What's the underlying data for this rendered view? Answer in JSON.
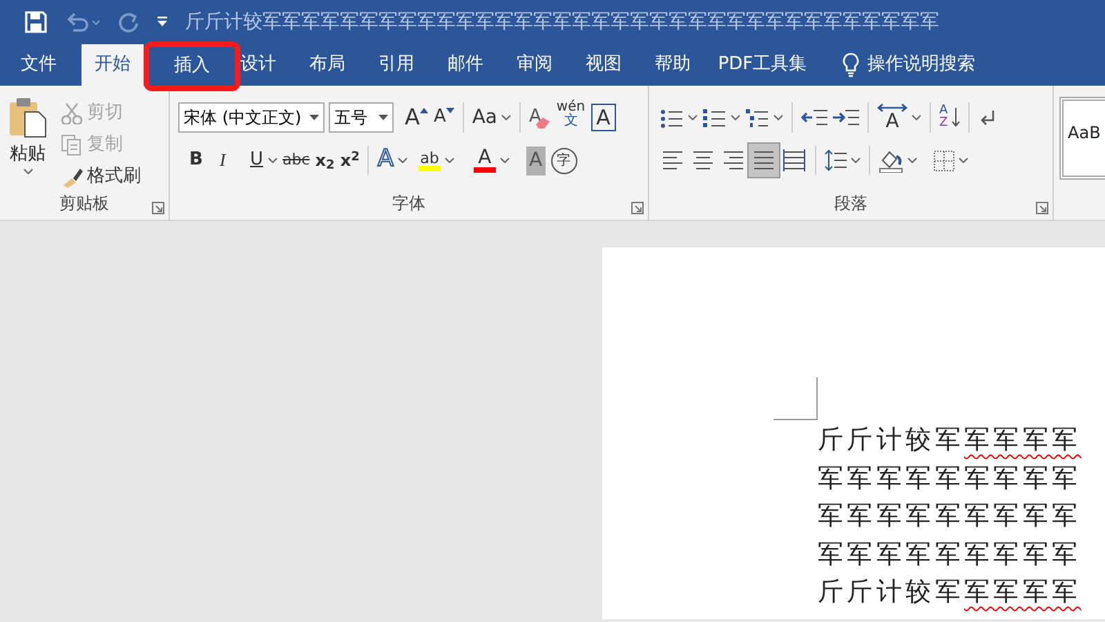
{
  "title_bar": {
    "title": "斤斤计较军军军军军军军军军军军军军军军军军军军军军军军军军军军军军军军军军军军"
  },
  "tabs": [
    {
      "label": "文件",
      "selected": false,
      "highlighted": false
    },
    {
      "label": "开始",
      "selected": true,
      "highlighted": false
    },
    {
      "label": "插入",
      "selected": false,
      "highlighted": true
    },
    {
      "label": "设计",
      "selected": false,
      "highlighted": false
    },
    {
      "label": "布局",
      "selected": false,
      "highlighted": false
    },
    {
      "label": "引用",
      "selected": false,
      "highlighted": false
    },
    {
      "label": "邮件",
      "selected": false,
      "highlighted": false
    },
    {
      "label": "审阅",
      "selected": false,
      "highlighted": false
    },
    {
      "label": "视图",
      "selected": false,
      "highlighted": false
    },
    {
      "label": "帮助",
      "selected": false,
      "highlighted": false
    },
    {
      "label": "PDF工具集",
      "selected": false,
      "highlighted": false
    }
  ],
  "tell_me": "操作说明搜索",
  "clipboard": {
    "paste": "粘贴",
    "cut": {
      "label": "剪切",
      "disabled": true
    },
    "copy": {
      "label": "复制",
      "disabled": true
    },
    "format_painter": {
      "label": "格式刷",
      "disabled": false
    },
    "label": "剪贴板"
  },
  "font": {
    "name": "宋体 (中文正文)",
    "size": "五号",
    "grow": "A",
    "shrink": "A",
    "change_case": "Aa",
    "clear_formatting": "A",
    "phonetic_top": "wén",
    "phonetic_bottom": "文",
    "char_border": "A",
    "bold": "B",
    "italic": "I",
    "underline": "U",
    "strikethrough": "abc",
    "subscript": "x$_{2}$",
    "superscript": "x$^{2}$",
    "text_effects": "A",
    "highlight_glyph": "ab",
    "font_color_glyph": "A",
    "shading": "A",
    "enclose": "字",
    "label": "字体"
  },
  "paragraph": {
    "asian_layout": "A",
    "sort_top": "A",
    "sort_bottom": "Z",
    "alignments": [
      {
        "selected": false
      },
      {
        "selected": false
      },
      {
        "selected": false
      },
      {
        "selected": true
      },
      {
        "selected": false
      }
    ],
    "label": "段落"
  },
  "styles": {
    "preview": "AaB"
  },
  "document": {
    "lines": [
      {
        "text": "斤斤计较军",
        "flagged": "军军军军"
      },
      {
        "text": "军军军军军军军军军"
      },
      {
        "text": "军军军军军军军军军"
      },
      {
        "text": "军军军军军军军军军"
      },
      {
        "text": "斤斤计较军",
        "flagged": "军军军军"
      }
    ]
  }
}
